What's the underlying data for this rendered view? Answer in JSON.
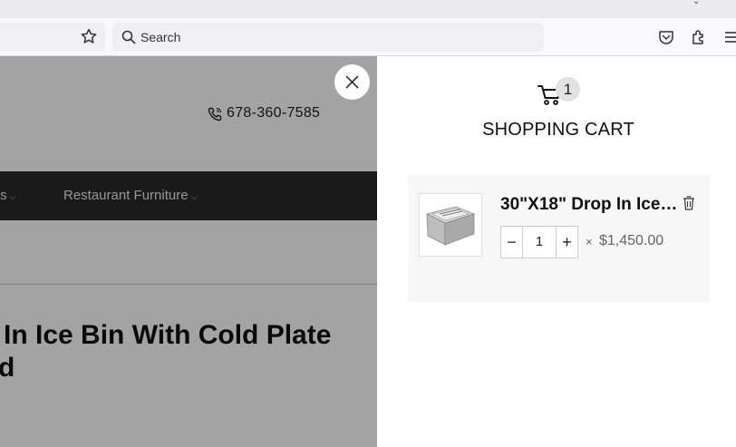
{
  "browser": {
    "search_placeholder": "Search",
    "icons": [
      "bookmark-star-icon",
      "search-icon",
      "pocket-icon",
      "extensions-icon",
      "menu-icon"
    ]
  },
  "page": {
    "phone": "678-360-7585",
    "nav": [
      {
        "label": "ts"
      },
      {
        "label": "Restaurant Furniture"
      }
    ],
    "title_line1": "In Ice Bin With Cold Plate",
    "title_line2": "d"
  },
  "cart": {
    "count": "1",
    "title": "SHOPPING CART",
    "items": [
      {
        "name": "30\"X18\" Drop In Ice ...",
        "quantity": "1",
        "multiply": "×",
        "price": "$1,450.00"
      }
    ]
  },
  "colors": {
    "navbar": "#2a2a2a",
    "overlay": "rgba(0,0,0,0.36)",
    "item_bg": "#f7f7f7"
  }
}
